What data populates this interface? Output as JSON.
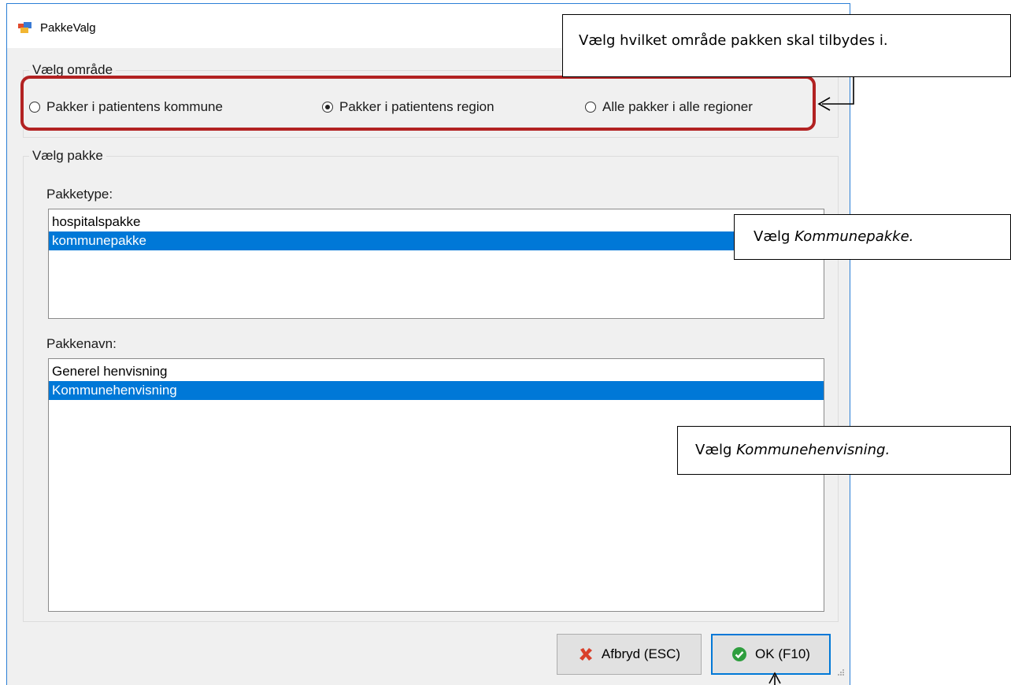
{
  "window": {
    "title": "PakkeValg",
    "icon": "app-window-icon"
  },
  "area_group": {
    "label": "Vælg område",
    "options": [
      {
        "label": "Pakker  i patientens kommune",
        "checked": false
      },
      {
        "label": "Pakker i patientens region",
        "checked": true
      },
      {
        "label": "Alle pakker i alle regioner",
        "checked": false
      }
    ]
  },
  "package_group": {
    "label": "Vælg pakke",
    "type_label": "Pakketype:",
    "type_items": [
      {
        "text": "hospitalspakke",
        "selected": false
      },
      {
        "text": "kommunepakke",
        "selected": true
      }
    ],
    "name_label": "Pakkenavn:",
    "name_items": [
      {
        "text": "Generel henvisning",
        "selected": false
      },
      {
        "text": "Kommunehenvisning",
        "selected": true
      }
    ]
  },
  "buttons": {
    "cancel": {
      "label": "Afbryd (ESC)",
      "icon": "red-x-icon"
    },
    "ok": {
      "label": "OK (F10)",
      "icon": "green-check-icon"
    }
  },
  "callouts": {
    "area": {
      "text": "Vælg hvilket område pakken skal tilbydes i."
    },
    "type": {
      "prefix": "Vælg ",
      "emph": "Kommunepakke."
    },
    "name": {
      "prefix": "Vælg ",
      "emph": "Kommunehenvisning."
    }
  },
  "colors": {
    "selection": "#0078d7",
    "highlight_border": "#b22222",
    "window_border": "#2b7fd6"
  }
}
